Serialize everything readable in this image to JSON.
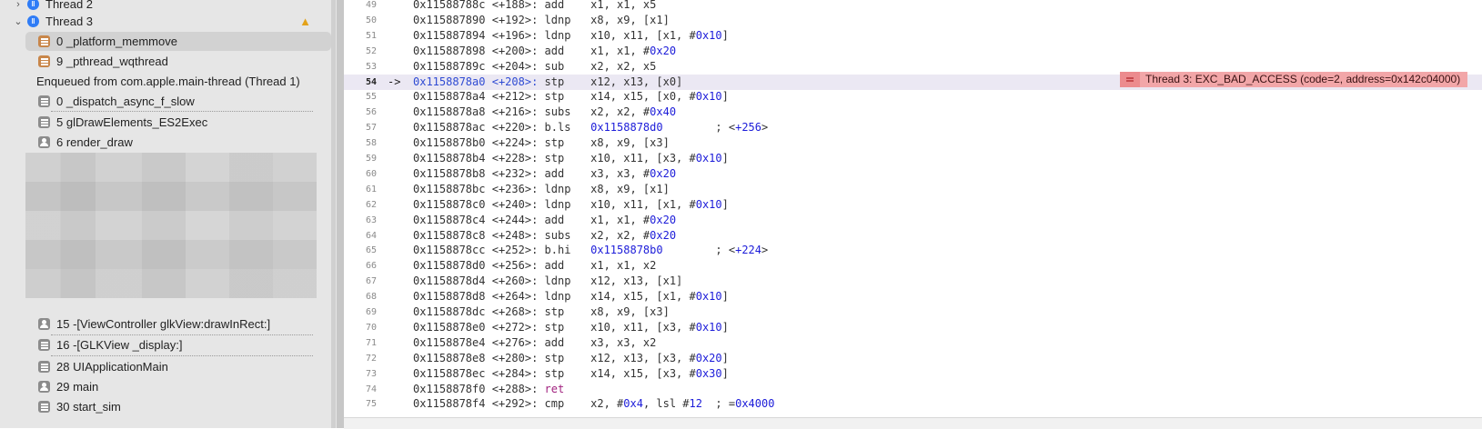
{
  "navigator": {
    "thread2_label": "Thread 2",
    "thread3_label": "Thread 3",
    "frames": [
      {
        "label": "0 _platform_memmove"
      },
      {
        "label": "9 _pthread_wqthread"
      }
    ],
    "enqueued_label": "Enqueued from com.apple.main-thread (Thread 1)",
    "enqueued_frames": [
      {
        "label": "0 _dispatch_async_f_slow"
      },
      {
        "label": "5 glDrawElements_ES2Exec"
      },
      {
        "label": "6 render_draw"
      }
    ],
    "lower_frames": [
      {
        "label": "15 -[ViewController glkView:drawInRect:]"
      },
      {
        "label": "16 -[GLKView _display:]"
      },
      {
        "label": "28 UIApplicationMain"
      },
      {
        "label": "29 main"
      },
      {
        "label": "30 start_sim"
      }
    ]
  },
  "disassembly": {
    "current_arrow": "->",
    "lines": [
      {
        "ln": "49",
        "addr": "0x11588788c",
        "off": "<+188>:",
        "mn": "add",
        "ops": "x1, x1, x5"
      },
      {
        "ln": "50",
        "addr": "0x115887890",
        "off": "<+192>:",
        "mn": "ldnp",
        "ops": "x8, x9, [x1]"
      },
      {
        "ln": "51",
        "addr": "0x115887894",
        "off": "<+196>:",
        "mn": "ldnp",
        "ops": "x10, x11, [x1, #",
        "num": "0x10",
        "tail": "]"
      },
      {
        "ln": "52",
        "addr": "0x115887898",
        "off": "<+200>:",
        "mn": "add",
        "ops": "x1, x1, #",
        "num": "0x20"
      },
      {
        "ln": "53",
        "addr": "0x11588789c",
        "off": "<+204>:",
        "mn": "sub",
        "ops": "x2, x2, x5"
      },
      {
        "ln": "54",
        "addr": "0x1158878a0",
        "off": "<+208>:",
        "mn": "stp",
        "ops": "x12, x13, [x0]",
        "current": true
      },
      {
        "ln": "55",
        "addr": "0x1158878a4",
        "off": "<+212>:",
        "mn": "stp",
        "ops": "x14, x15, [x0, #",
        "num": "0x10",
        "tail": "]"
      },
      {
        "ln": "56",
        "addr": "0x1158878a8",
        "off": "<+216>:",
        "mn": "subs",
        "ops": "x2, x2, #",
        "num": "0x40"
      },
      {
        "ln": "57",
        "addr": "0x1158878ac",
        "off": "<+220>:",
        "mn": "b.ls",
        "target": "0x1158878d0",
        "comment": "; <",
        "cnum": "+256",
        "ctail": ">"
      },
      {
        "ln": "58",
        "addr": "0x1158878b0",
        "off": "<+224>:",
        "mn": "stp",
        "ops": "x8, x9, [x3]"
      },
      {
        "ln": "59",
        "addr": "0x1158878b4",
        "off": "<+228>:",
        "mn": "stp",
        "ops": "x10, x11, [x3, #",
        "num": "0x10",
        "tail": "]"
      },
      {
        "ln": "60",
        "addr": "0x1158878b8",
        "off": "<+232>:",
        "mn": "add",
        "ops": "x3, x3, #",
        "num": "0x20"
      },
      {
        "ln": "61",
        "addr": "0x1158878bc",
        "off": "<+236>:",
        "mn": "ldnp",
        "ops": "x8, x9, [x1]"
      },
      {
        "ln": "62",
        "addr": "0x1158878c0",
        "off": "<+240>:",
        "mn": "ldnp",
        "ops": "x10, x11, [x1, #",
        "num": "0x10",
        "tail": "]"
      },
      {
        "ln": "63",
        "addr": "0x1158878c4",
        "off": "<+244>:",
        "mn": "add",
        "ops": "x1, x1, #",
        "num": "0x20"
      },
      {
        "ln": "64",
        "addr": "0x1158878c8",
        "off": "<+248>:",
        "mn": "subs",
        "ops": "x2, x2, #",
        "num": "0x20"
      },
      {
        "ln": "65",
        "addr": "0x1158878cc",
        "off": "<+252>:",
        "mn": "b.hi",
        "target": "0x1158878b0",
        "comment": "; <",
        "cnum": "+224",
        "ctail": ">"
      },
      {
        "ln": "66",
        "addr": "0x1158878d0",
        "off": "<+256>:",
        "mn": "add",
        "ops": "x1, x1, x2"
      },
      {
        "ln": "67",
        "addr": "0x1158878d4",
        "off": "<+260>:",
        "mn": "ldnp",
        "ops": "x12, x13, [x1]"
      },
      {
        "ln": "68",
        "addr": "0x1158878d8",
        "off": "<+264>:",
        "mn": "ldnp",
        "ops": "x14, x15, [x1, #",
        "num": "0x10",
        "tail": "]"
      },
      {
        "ln": "69",
        "addr": "0x1158878dc",
        "off": "<+268>:",
        "mn": "stp",
        "ops": "x8, x9, [x3]"
      },
      {
        "ln": "70",
        "addr": "0x1158878e0",
        "off": "<+272>:",
        "mn": "stp",
        "ops": "x10, x11, [x3, #",
        "num": "0x10",
        "tail": "]"
      },
      {
        "ln": "71",
        "addr": "0x1158878e4",
        "off": "<+276>:",
        "mn": "add",
        "ops": "x3, x3, x2"
      },
      {
        "ln": "72",
        "addr": "0x1158878e8",
        "off": "<+280>:",
        "mn": "stp",
        "ops": "x12, x13, [x3, #",
        "num": "0x20",
        "tail": "]"
      },
      {
        "ln": "73",
        "addr": "0x1158878ec",
        "off": "<+284>:",
        "mn": "stp",
        "ops": "x14, x15, [x3, #",
        "num": "0x30",
        "tail": "]"
      },
      {
        "ln": "74",
        "addr": "0x1158878f0",
        "off": "<+288>:",
        "mn": "ret",
        "isret": true
      },
      {
        "ln": "75",
        "addr": "0x1158878f4",
        "off": "<+292>:",
        "mn": "cmp",
        "ops": "x2, #",
        "num": "0x4",
        "tail": ", lsl #",
        "num2": "12",
        "comment": "; =",
        "cnum": "0x4000"
      }
    ]
  },
  "exception": {
    "text": "Thread 3: EXC_BAD_ACCESS (code=2, address=0x142c04000)"
  }
}
